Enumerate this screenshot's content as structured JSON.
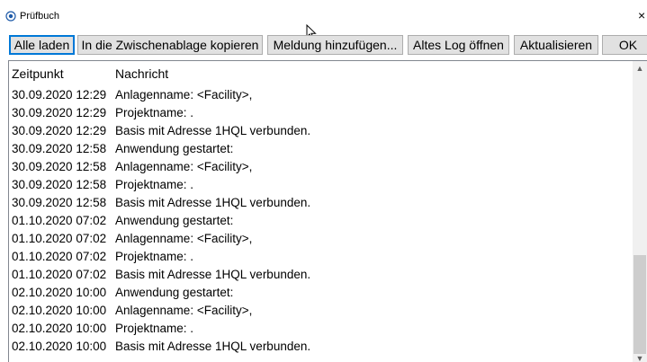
{
  "window": {
    "title": "Prüfbuch",
    "close_glyph": "×"
  },
  "toolbar": {
    "buttons": [
      {
        "label": "Alle laden"
      },
      {
        "label": "In die Zwischenablage kopieren"
      },
      {
        "label": "Meldung hinzufügen..."
      },
      {
        "label": "Altes Log öffnen"
      },
      {
        "label": "Aktualisieren"
      },
      {
        "label": "OK"
      }
    ]
  },
  "log": {
    "columns": [
      "Zeitpunkt",
      "Nachricht"
    ],
    "rows": [
      [
        "30.09.2020 12:29",
        "Anlagenname: <Facility>,"
      ],
      [
        "30.09.2020 12:29",
        "Projektname: ."
      ],
      [
        "30.09.2020 12:29",
        "Basis mit Adresse 1HQL verbunden."
      ],
      [
        "30.09.2020 12:58",
        "Anwendung gestartet:"
      ],
      [
        "30.09.2020 12:58",
        "Anlagenname: <Facility>,"
      ],
      [
        "30.09.2020 12:58",
        "Projektname: ."
      ],
      [
        "30.09.2020 12:58",
        "Basis mit Adresse 1HQL verbunden."
      ],
      [
        "01.10.2020 07:02",
        "Anwendung gestartet:"
      ],
      [
        "01.10.2020 07:02",
        "Anlagenname: <Facility>,"
      ],
      [
        "01.10.2020 07:02",
        "Projektname: ."
      ],
      [
        "01.10.2020 07:02",
        "Basis mit Adresse 1HQL verbunden."
      ],
      [
        "02.10.2020 10:00",
        "Anwendung gestartet:"
      ],
      [
        "02.10.2020 10:00",
        "Anlagenname: <Facility>,"
      ],
      [
        "02.10.2020 10:00",
        "Projektname: ."
      ],
      [
        "02.10.2020 10:00",
        "Basis mit Adresse 1HQL verbunden."
      ]
    ]
  },
  "scrollbar": {
    "position_fraction": 0.72
  },
  "colors": {
    "focus_border": "#0078d7",
    "button_face": "#e1e1e1",
    "scroll_thumb": "#cdcdcd"
  }
}
